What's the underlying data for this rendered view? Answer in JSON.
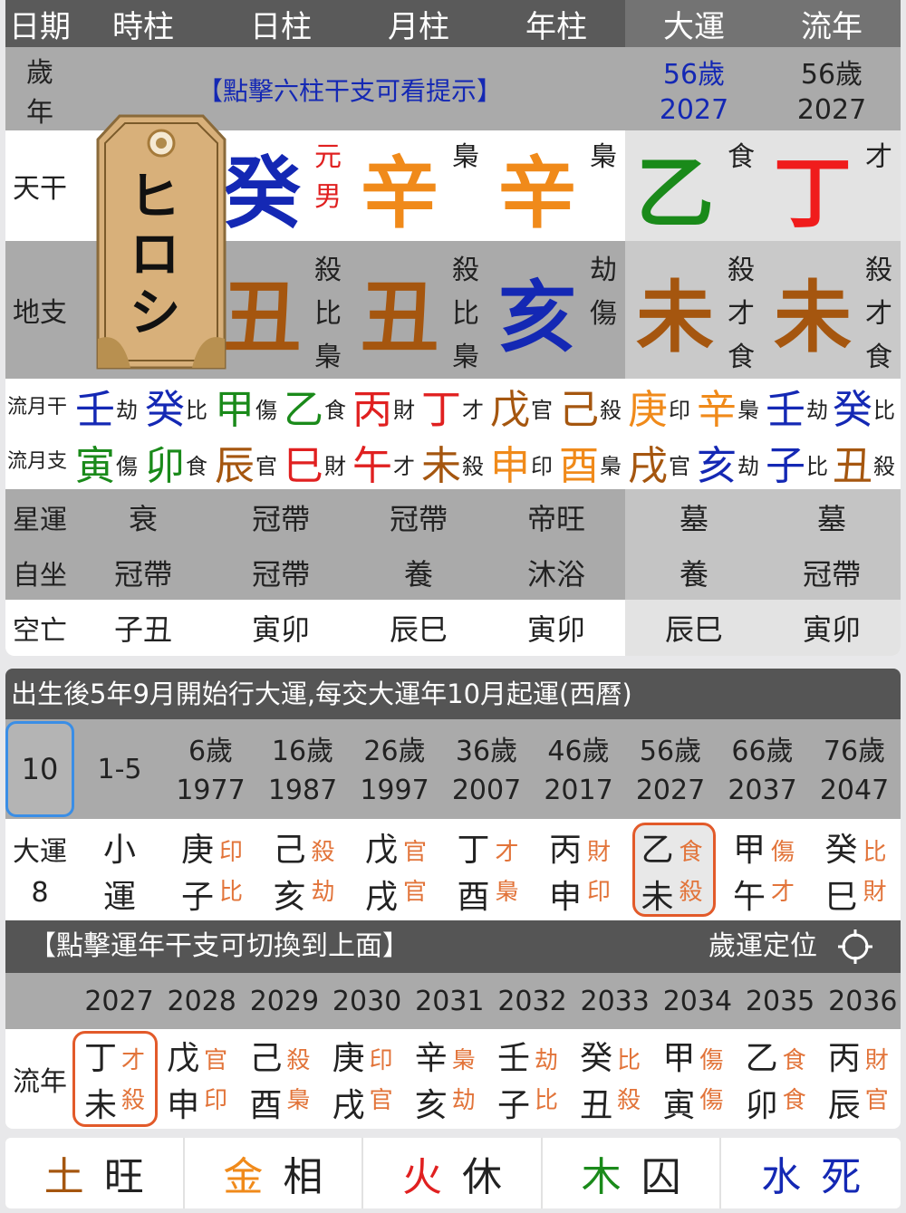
{
  "header": {
    "labels": [
      "日期",
      "時柱",
      "日柱",
      "月柱",
      "年柱",
      "大運",
      "流年"
    ]
  },
  "age_row": {
    "label_top": "歲",
    "label_bottom": "年",
    "hint": "【點擊六柱干支可看提示】",
    "dayun_age": "56歲",
    "dayun_year": "2027",
    "liunian_age": "56歲",
    "liunian_year": "2027"
  },
  "tag": {
    "text": "ヒロシ"
  },
  "tiangan": {
    "label": "天干",
    "items": [
      {
        "char": "癸",
        "color": "#1428b4",
        "side": [
          "元",
          "男"
        ],
        "side_color": "#e02020"
      },
      {
        "char": "辛",
        "color": "#f08a1a",
        "side": [
          "梟"
        ],
        "side_color": "#222"
      },
      {
        "char": "辛",
        "color": "#f08a1a",
        "side": [
          "梟"
        ],
        "side_color": "#222"
      },
      {
        "char": "乙",
        "color": "#1a8a1a",
        "side": [
          "食"
        ],
        "side_color": "#222"
      },
      {
        "char": "丁",
        "color": "#f01c1c",
        "side": [
          "才"
        ],
        "side_color": "#222"
      }
    ]
  },
  "dizhi": {
    "label": "地支",
    "items": [
      {
        "char": "丑",
        "color": "#a5560f",
        "side": [
          "殺",
          "比",
          "梟"
        ]
      },
      {
        "char": "丑",
        "color": "#a5560f",
        "side": [
          "殺",
          "比",
          "梟"
        ]
      },
      {
        "char": "亥",
        "color": "#1428b4",
        "side": [
          "劫",
          "傷"
        ]
      },
      {
        "char": "未",
        "color": "#a5560f",
        "side": [
          "殺",
          "才",
          "食"
        ]
      },
      {
        "char": "未",
        "color": "#a5560f",
        "side": [
          "殺",
          "才",
          "食"
        ]
      }
    ]
  },
  "liuyue": {
    "gan_label": "流月干",
    "zhi_label": "流月支",
    "gan": [
      {
        "c": "壬",
        "s": "劫",
        "color": "#1428b4"
      },
      {
        "c": "癸",
        "s": "比",
        "color": "#1428b4"
      },
      {
        "c": "甲",
        "s": "傷",
        "color": "#1a8a1a"
      },
      {
        "c": "乙",
        "s": "食",
        "color": "#1a8a1a"
      },
      {
        "c": "丙",
        "s": "財",
        "color": "#e02020"
      },
      {
        "c": "丁",
        "s": "才",
        "color": "#e02020"
      },
      {
        "c": "戊",
        "s": "官",
        "color": "#a5560f"
      },
      {
        "c": "己",
        "s": "殺",
        "color": "#a5560f"
      },
      {
        "c": "庚",
        "s": "印",
        "color": "#f08a1a"
      },
      {
        "c": "辛",
        "s": "梟",
        "color": "#f08a1a"
      },
      {
        "c": "壬",
        "s": "劫",
        "color": "#1428b4"
      },
      {
        "c": "癸",
        "s": "比",
        "color": "#1428b4"
      }
    ],
    "zhi": [
      {
        "c": "寅",
        "s": "傷",
        "color": "#1a8a1a"
      },
      {
        "c": "卯",
        "s": "食",
        "color": "#1a8a1a"
      },
      {
        "c": "辰",
        "s": "官",
        "color": "#a5560f"
      },
      {
        "c": "巳",
        "s": "財",
        "color": "#e02020"
      },
      {
        "c": "午",
        "s": "才",
        "color": "#e02020"
      },
      {
        "c": "未",
        "s": "殺",
        "color": "#a5560f"
      },
      {
        "c": "申",
        "s": "印",
        "color": "#f08a1a"
      },
      {
        "c": "酉",
        "s": "梟",
        "color": "#f08a1a"
      },
      {
        "c": "戌",
        "s": "官",
        "color": "#a5560f"
      },
      {
        "c": "亥",
        "s": "劫",
        "color": "#1428b4"
      },
      {
        "c": "子",
        "s": "比",
        "color": "#1428b4"
      },
      {
        "c": "丑",
        "s": "殺",
        "color": "#a5560f"
      }
    ]
  },
  "xingyun": {
    "label": "星運",
    "values": [
      "衰",
      "冠帶",
      "冠帶",
      "帝旺",
      "墓",
      "墓"
    ]
  },
  "zizuo": {
    "label": "自坐",
    "values": [
      "冠帶",
      "冠帶",
      "養",
      "沐浴",
      "養",
      "冠帶"
    ]
  },
  "kongwang": {
    "label": "空亡",
    "values": [
      "子丑",
      "寅卯",
      "辰巳",
      "寅卯",
      "辰巳",
      "寅卯"
    ]
  },
  "dayun_header": "出生後5年9月開始行大運,每交大運年10月起運(西曆)",
  "dayun_ages": {
    "selected": "10",
    "xiao": "1-5",
    "items": [
      {
        "age": "6歲",
        "year": "1977"
      },
      {
        "age": "16歲",
        "year": "1987"
      },
      {
        "age": "26歲",
        "year": "1997"
      },
      {
        "age": "36歲",
        "year": "2007"
      },
      {
        "age": "46歲",
        "year": "2017"
      },
      {
        "age": "56歲",
        "year": "2027"
      },
      {
        "age": "66歲",
        "year": "2037"
      },
      {
        "age": "76歲",
        "year": "2047"
      }
    ]
  },
  "dayun_row": {
    "label": "大運",
    "count": "8",
    "xiao_top": "小",
    "xiao_bottom": "運",
    "items": [
      {
        "g": "庚",
        "gs": "印",
        "z": "子",
        "zs": "比"
      },
      {
        "g": "己",
        "gs": "殺",
        "z": "亥",
        "zs": "劫"
      },
      {
        "g": "戊",
        "gs": "官",
        "z": "戌",
        "zs": "官"
      },
      {
        "g": "丁",
        "gs": "才",
        "z": "酉",
        "zs": "梟"
      },
      {
        "g": "丙",
        "gs": "財",
        "z": "申",
        "zs": "印"
      },
      {
        "g": "乙",
        "gs": "食",
        "z": "未",
        "zs": "殺"
      },
      {
        "g": "甲",
        "gs": "傷",
        "z": "午",
        "zs": "才"
      },
      {
        "g": "癸",
        "gs": "比",
        "z": "巳",
        "zs": "財"
      }
    ]
  },
  "liunian_header": {
    "hint": "【點擊運年干支可切換到上面】",
    "locate": "歲運定位"
  },
  "liunian_years": [
    "2027",
    "2028",
    "2029",
    "2030",
    "2031",
    "2032",
    "2033",
    "2034",
    "2035",
    "2036"
  ],
  "liunian_row": {
    "label": "流年",
    "items": [
      {
        "g": "丁",
        "gs": "才",
        "z": "未",
        "zs": "殺"
      },
      {
        "g": "戊",
        "gs": "官",
        "z": "申",
        "zs": "印"
      },
      {
        "g": "己",
        "gs": "殺",
        "z": "酉",
        "zs": "梟"
      },
      {
        "g": "庚",
        "gs": "印",
        "z": "戌",
        "zs": "官"
      },
      {
        "g": "辛",
        "gs": "梟",
        "z": "亥",
        "zs": "劫"
      },
      {
        "g": "壬",
        "gs": "劫",
        "z": "子",
        "zs": "比"
      },
      {
        "g": "癸",
        "gs": "比",
        "z": "丑",
        "zs": "殺"
      },
      {
        "g": "甲",
        "gs": "傷",
        "z": "寅",
        "zs": "傷"
      },
      {
        "g": "乙",
        "gs": "食",
        "z": "卯",
        "zs": "食"
      },
      {
        "g": "丙",
        "gs": "財",
        "z": "辰",
        "zs": "官"
      }
    ]
  },
  "wuxing": [
    {
      "el": "土",
      "state": "旺",
      "color": "#a5560f"
    },
    {
      "el": "金",
      "state": "相",
      "color": "#f08a1a"
    },
    {
      "el": "火",
      "state": "休",
      "color": "#e02020"
    },
    {
      "el": "木",
      "state": "囚",
      "color": "#1a8a1a"
    },
    {
      "el": "水",
      "state": "死",
      "color": "#1428b4"
    }
  ],
  "colors": {
    "accent_blue": "#3a8ee6",
    "highlight_box": "#e25a2a"
  }
}
